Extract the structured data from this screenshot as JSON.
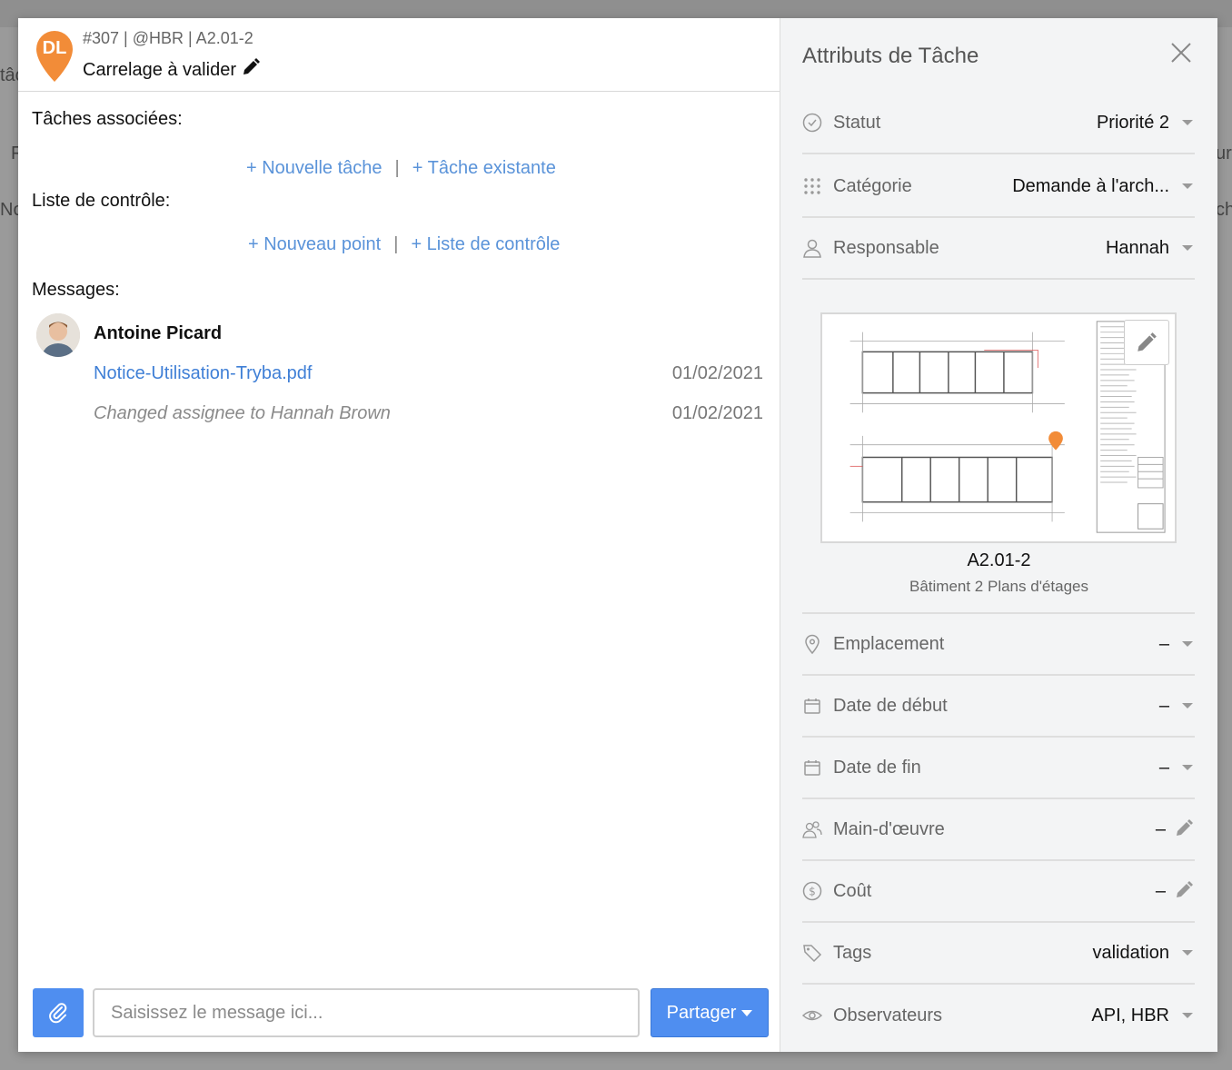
{
  "background": {
    "fragments": [
      "tâc",
      "F",
      "No",
      "ur",
      "ch"
    ]
  },
  "task": {
    "initials": "DL",
    "pin_color": "#f28c38",
    "meta": "#307 | @HBR | A2.01-2",
    "title": "Carrelage à valider"
  },
  "sections": {
    "associated_tasks": "Tâches associées:",
    "new_task": "+ Nouvelle tâche",
    "existing_task": "+ Tâche existante",
    "separator": "|",
    "checklist": "Liste de contrôle:",
    "new_point": "+ Nouveau point",
    "checklist_link": "+ Liste de contrôle",
    "messages": "Messages:"
  },
  "message": {
    "author": "Antoine Picard",
    "file": "Notice-Utilisation-Tryba.pdf",
    "file_date": "01/02/2021",
    "note": "Changed assignee to Hannah Brown",
    "note_date": "01/02/2021"
  },
  "composer": {
    "placeholder": "Saisissez le message ici...",
    "share_label": "Partager"
  },
  "panel": {
    "title": "Attributs de Tâche",
    "attributes": {
      "status": {
        "label": "Statut",
        "value": "Priorité 2"
      },
      "category": {
        "label": "Catégorie",
        "value": "Demande à l'arch..."
      },
      "assignee": {
        "label": "Responsable",
        "value": "Hannah"
      },
      "location": {
        "label": "Emplacement",
        "value": "–"
      },
      "start": {
        "label": "Date de début",
        "value": "–"
      },
      "end": {
        "label": "Date de fin",
        "value": "–"
      },
      "labor": {
        "label": "Main-d'œuvre",
        "value": "–"
      },
      "cost": {
        "label": "Coût",
        "value": "–"
      },
      "tags": {
        "label": "Tags",
        "value": "validation"
      },
      "watchers": {
        "label": "Observateurs",
        "value": "API, HBR"
      }
    },
    "sheet": {
      "code": "A2.01-2",
      "name": "Bâtiment 2 Plans d'étages"
    }
  },
  "colors": {
    "accent_blue": "#4f8ef0",
    "link_blue": "#5a93d9",
    "pin_orange": "#f28c38"
  }
}
